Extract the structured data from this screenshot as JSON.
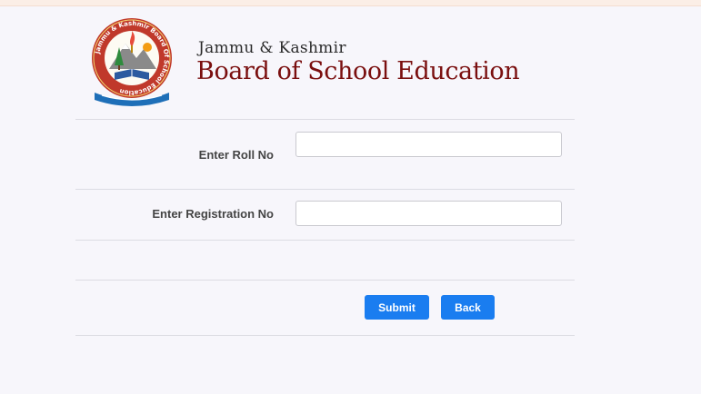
{
  "header": {
    "org_line1": "Jammu & Kashmir",
    "org_line2": "Board of School Education",
    "logo_ring_text": "Jammu & Kashmir Board Of School Education"
  },
  "form": {
    "roll": {
      "label": "Enter Roll No",
      "value": "",
      "placeholder": ""
    },
    "registration": {
      "label": "Enter Registration No",
      "value": "",
      "placeholder": ""
    }
  },
  "actions": {
    "submit_label": "Submit",
    "back_label": "Back"
  },
  "colors": {
    "brand_text": "#7a0f0f",
    "button_bg": "#1a7df0",
    "page_bg": "#f7f6fb"
  }
}
